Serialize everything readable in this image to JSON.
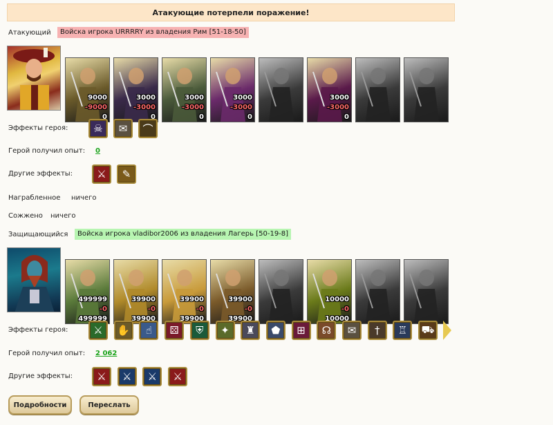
{
  "banner": "Атакующие потерпели поражение!",
  "attacker": {
    "label": "Атакующий",
    "army": "Войска игрока URRRRY из владения Рим [51-18-50]",
    "units": [
      {
        "icon": "ogre-unit-icon",
        "n1": "9000",
        "n2": "-9000",
        "n3": "0",
        "loss": true,
        "grey": false
      },
      {
        "icon": "assassin-unit-icon",
        "n1": "3000",
        "n2": "-3000",
        "n3": "0",
        "loss": true,
        "grey": false
      },
      {
        "icon": "lizard-rider-unit-icon",
        "n1": "3000",
        "n2": "-3000",
        "n3": "0",
        "loss": true,
        "grey": false
      },
      {
        "icon": "harpy-unit-icon",
        "n1": "3000",
        "n2": "-3000",
        "n3": "0",
        "loss": true,
        "grey": false
      },
      {
        "icon": "archer-unit-icon",
        "n1": "",
        "n2": "",
        "n3": "",
        "loss": false,
        "grey": true
      },
      {
        "icon": "witch-unit-icon",
        "n1": "3000",
        "n2": "-3000",
        "n3": "0",
        "loss": true,
        "grey": false
      },
      {
        "icon": "dark-knight-unit-icon",
        "n1": "",
        "n2": "",
        "n3": "",
        "loss": false,
        "grey": true
      },
      {
        "icon": "spider-rider-unit-icon",
        "n1": "",
        "n2": "",
        "n3": "",
        "loss": false,
        "grey": true
      }
    ],
    "hero_effects_label": "Эффекты героя:",
    "hero_effects": [
      "mask-icon",
      "scroll-icon",
      "bow-icon"
    ],
    "xp_label": "Герой получил опыт:",
    "xp_value": "0",
    "other_effects_label": "Другие эффекты:",
    "other_effects": [
      "sword-effect-icon",
      "scroll-bundle-icon"
    ],
    "plunder_label": "Награбленное",
    "plunder_value": "ничего",
    "burned_label": "Сожжено",
    "burned_value": "ничего"
  },
  "defender": {
    "label": "Защищающийся",
    "army": "Войска игрока vladibor2006 из владения Лагерь [50-19-8]",
    "units": [
      {
        "icon": "peasant-unit-icon",
        "n1": "499999",
        "n2": "-0",
        "n3": "499999",
        "loss": true,
        "grey": false
      },
      {
        "icon": "golden-warrior-unit-icon",
        "n1": "39900",
        "n2": "-0",
        "n3": "39900",
        "loss": true,
        "grey": false
      },
      {
        "icon": "knight-unit-icon",
        "n1": "39900",
        "n2": "-0",
        "n3": "39900",
        "loss": true,
        "grey": false
      },
      {
        "icon": "griffin-unit-icon",
        "n1": "39900",
        "n2": "-0",
        "n3": "39900",
        "loss": true,
        "grey": false
      },
      {
        "icon": "crossbowman-unit-icon",
        "n1": "",
        "n2": "",
        "n3": "",
        "loss": false,
        "grey": true
      },
      {
        "icon": "monk-unit-icon",
        "n1": "10000",
        "n2": "-0",
        "n3": "10000",
        "loss": true,
        "grey": false
      },
      {
        "icon": "barbarian-unit-icon",
        "n1": "",
        "n2": "",
        "n3": "",
        "loss": false,
        "grey": true
      },
      {
        "icon": "horseman-unit-icon",
        "n1": "",
        "n2": "",
        "n3": "",
        "loss": false,
        "grey": true
      }
    ],
    "hero_effects_label": "Эффекты героя:",
    "hero_effects": [
      "sword-icon",
      "handshake-icon",
      "hand-icon",
      "dice-icon",
      "shield-icon",
      "shield-star-icon",
      "tower-icon",
      "pentagon-icon",
      "gate-icon",
      "ear-icon",
      "scroll-icon",
      "dagger-icon",
      "armor-icon",
      "cart-icon"
    ],
    "xp_label": "Герой получил опыт:",
    "xp_value": "2 062",
    "other_effects_label": "Другие эффекты:",
    "other_effects": [
      "sword-effect-icon",
      "blue-sword-icon",
      "blue-sword-icon",
      "sword-effect-icon"
    ]
  },
  "buttons": {
    "details": "Подробности",
    "forward": "Переслать"
  },
  "colors": {
    "attacker_tag": "#f7b2b2",
    "defender_tag": "#b7f5b1",
    "banner": "#fde6c8",
    "xp_link": "#1ba31b"
  }
}
